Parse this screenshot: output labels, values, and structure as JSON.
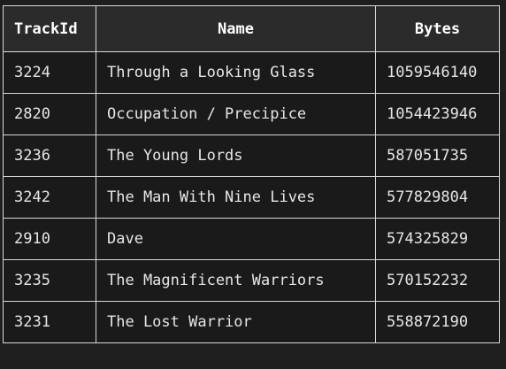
{
  "table": {
    "columns": [
      "TrackId",
      "Name",
      "Bytes"
    ],
    "rows": [
      [
        "3224",
        "Through a Looking Glass",
        "1059546140"
      ],
      [
        "2820",
        "Occupation / Precipice",
        "1054423946"
      ],
      [
        "3236",
        "The Young Lords",
        "587051735"
      ],
      [
        "3242",
        "The Man With Nine Lives",
        "577829804"
      ],
      [
        "2910",
        "Dave",
        "574325829"
      ],
      [
        "3235",
        "The Magnificent Warriors",
        "570152232"
      ],
      [
        "3231",
        "The Lost Warrior",
        "558872190"
      ]
    ]
  }
}
